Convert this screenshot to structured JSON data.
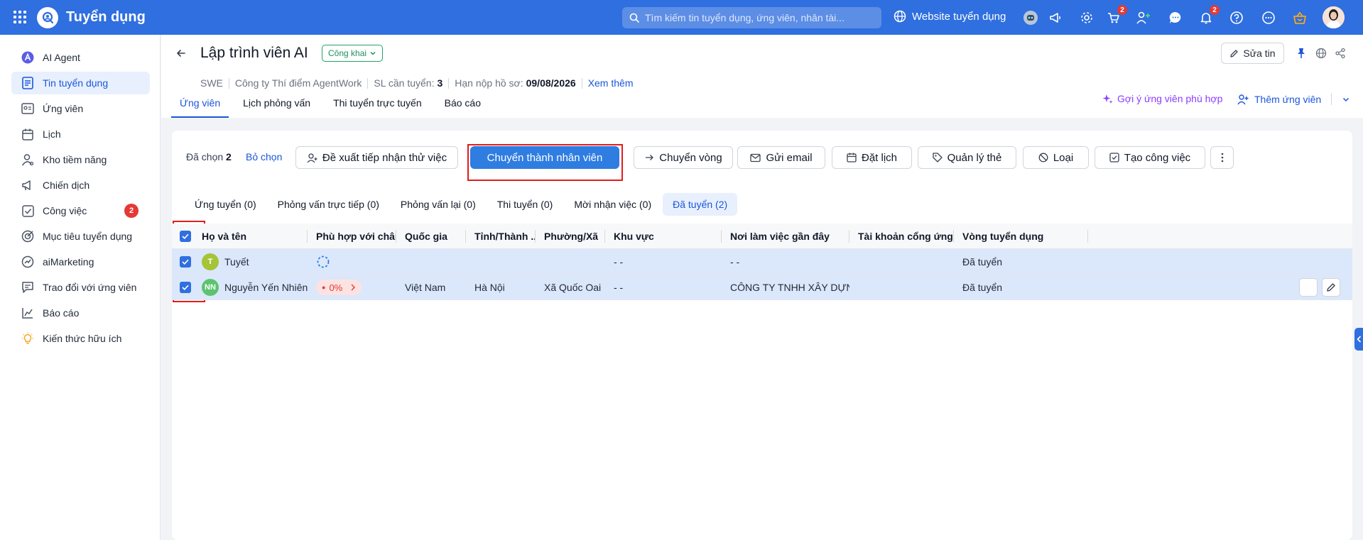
{
  "topbar": {
    "app_title": "Tuyển dụng",
    "search_placeholder": "Tìm kiếm tin tuyển dụng, ứng viên, nhân tài...",
    "website_link": "Website tuyển dụng",
    "cart_badge": "2",
    "notification_badge": "2"
  },
  "sidebar": {
    "items": [
      {
        "label": "AI Agent",
        "icon": "ai-agent-icon"
      },
      {
        "label": "Tin tuyển dụng",
        "icon": "job-post-icon"
      },
      {
        "label": "Ứng viên",
        "icon": "candidate-icon"
      },
      {
        "label": "Lịch",
        "icon": "calendar-icon"
      },
      {
        "label": "Kho tiềm năng",
        "icon": "talent-pool-icon"
      },
      {
        "label": "Chiến dịch",
        "icon": "megaphone-icon"
      },
      {
        "label": "Công việc",
        "icon": "task-icon",
        "badge": "2"
      },
      {
        "label": "Mục tiêu tuyển dụng",
        "icon": "target-icon"
      },
      {
        "label": "aiMarketing",
        "icon": "marketing-icon"
      },
      {
        "label": "Trao đổi với ứng viên",
        "icon": "chat-icon"
      },
      {
        "label": "Báo cáo",
        "icon": "report-icon"
      },
      {
        "label": "Kiến thức hữu ích",
        "icon": "lightbulb-icon"
      }
    ]
  },
  "header": {
    "title": "Lập trình viên AI",
    "status": "Công khai",
    "edit_label": "Sửa tin",
    "meta": {
      "code": "SWE",
      "company": "Công ty Thí điểm AgentWork",
      "quantity_label": "SL cần tuyển:",
      "quantity_value": "3",
      "deadline_label": "Hạn nộp hồ sơ:",
      "deadline_value": "09/08/2026",
      "more_link": "Xem thêm"
    },
    "tabs": [
      "Ứng viên",
      "Lịch phỏng vấn",
      "Thi tuyển trực tuyến",
      "Báo cáo"
    ],
    "suggest_label": "Gợi ý ứng viên phù hợp",
    "add_candidate_label": "Thêm ứng viên"
  },
  "actions": {
    "selected_label": "Đã chọn",
    "selected_count": "2",
    "unselect_label": "Bỏ chọn",
    "buttons": [
      "Đề xuất tiếp nhận thử việc",
      "Chuyển thành nhân viên",
      "Chuyển vòng",
      "Gửi email",
      "Đặt lịch",
      "Quản lý thẻ",
      "Loại",
      "Tạo công việc"
    ]
  },
  "stage_tabs": [
    "Ứng tuyển (0)",
    "Phỏng vấn trực tiếp (0)",
    "Phỏng vấn lại (0)",
    "Thi tuyển (0)",
    "Mời nhận việc (0)",
    "Đã tuyển (2)"
  ],
  "table": {
    "columns": [
      "Họ và tên",
      "Phù hợp với chân ...",
      "Quốc gia",
      "Tỉnh/Thành ...",
      "Phường/Xã",
      "Khu vực",
      "Nơi làm việc gần đây",
      "Tài khoản cổng ứng viên",
      "Vòng tuyển dụng"
    ],
    "rows": [
      {
        "initials": "T",
        "avatar_color": "#a5c437",
        "name": "Tuyết",
        "match": "",
        "country": "",
        "province": "",
        "ward": "",
        "area": "- -",
        "recent_workplace": "- -",
        "portal_account": "",
        "stage": "Đã tuyển"
      },
      {
        "initials": "NN",
        "avatar_color": "#5cc46e",
        "name": "Nguyễn Yến Nhiên",
        "match": "0%",
        "country": "Việt Nam",
        "province": "Hà Nội",
        "ward": "Xã Quốc Oai",
        "area": "- -",
        "recent_workplace": "CÔNG TY TNHH XÂY DỰNG VÀ",
        "portal_account": "",
        "stage": "Đã tuyển"
      }
    ]
  },
  "colors": {
    "primary": "#2f6fdf",
    "highlight_frame": "#e11d1d",
    "badge": "#e53935",
    "status_green": "#22a06b"
  }
}
